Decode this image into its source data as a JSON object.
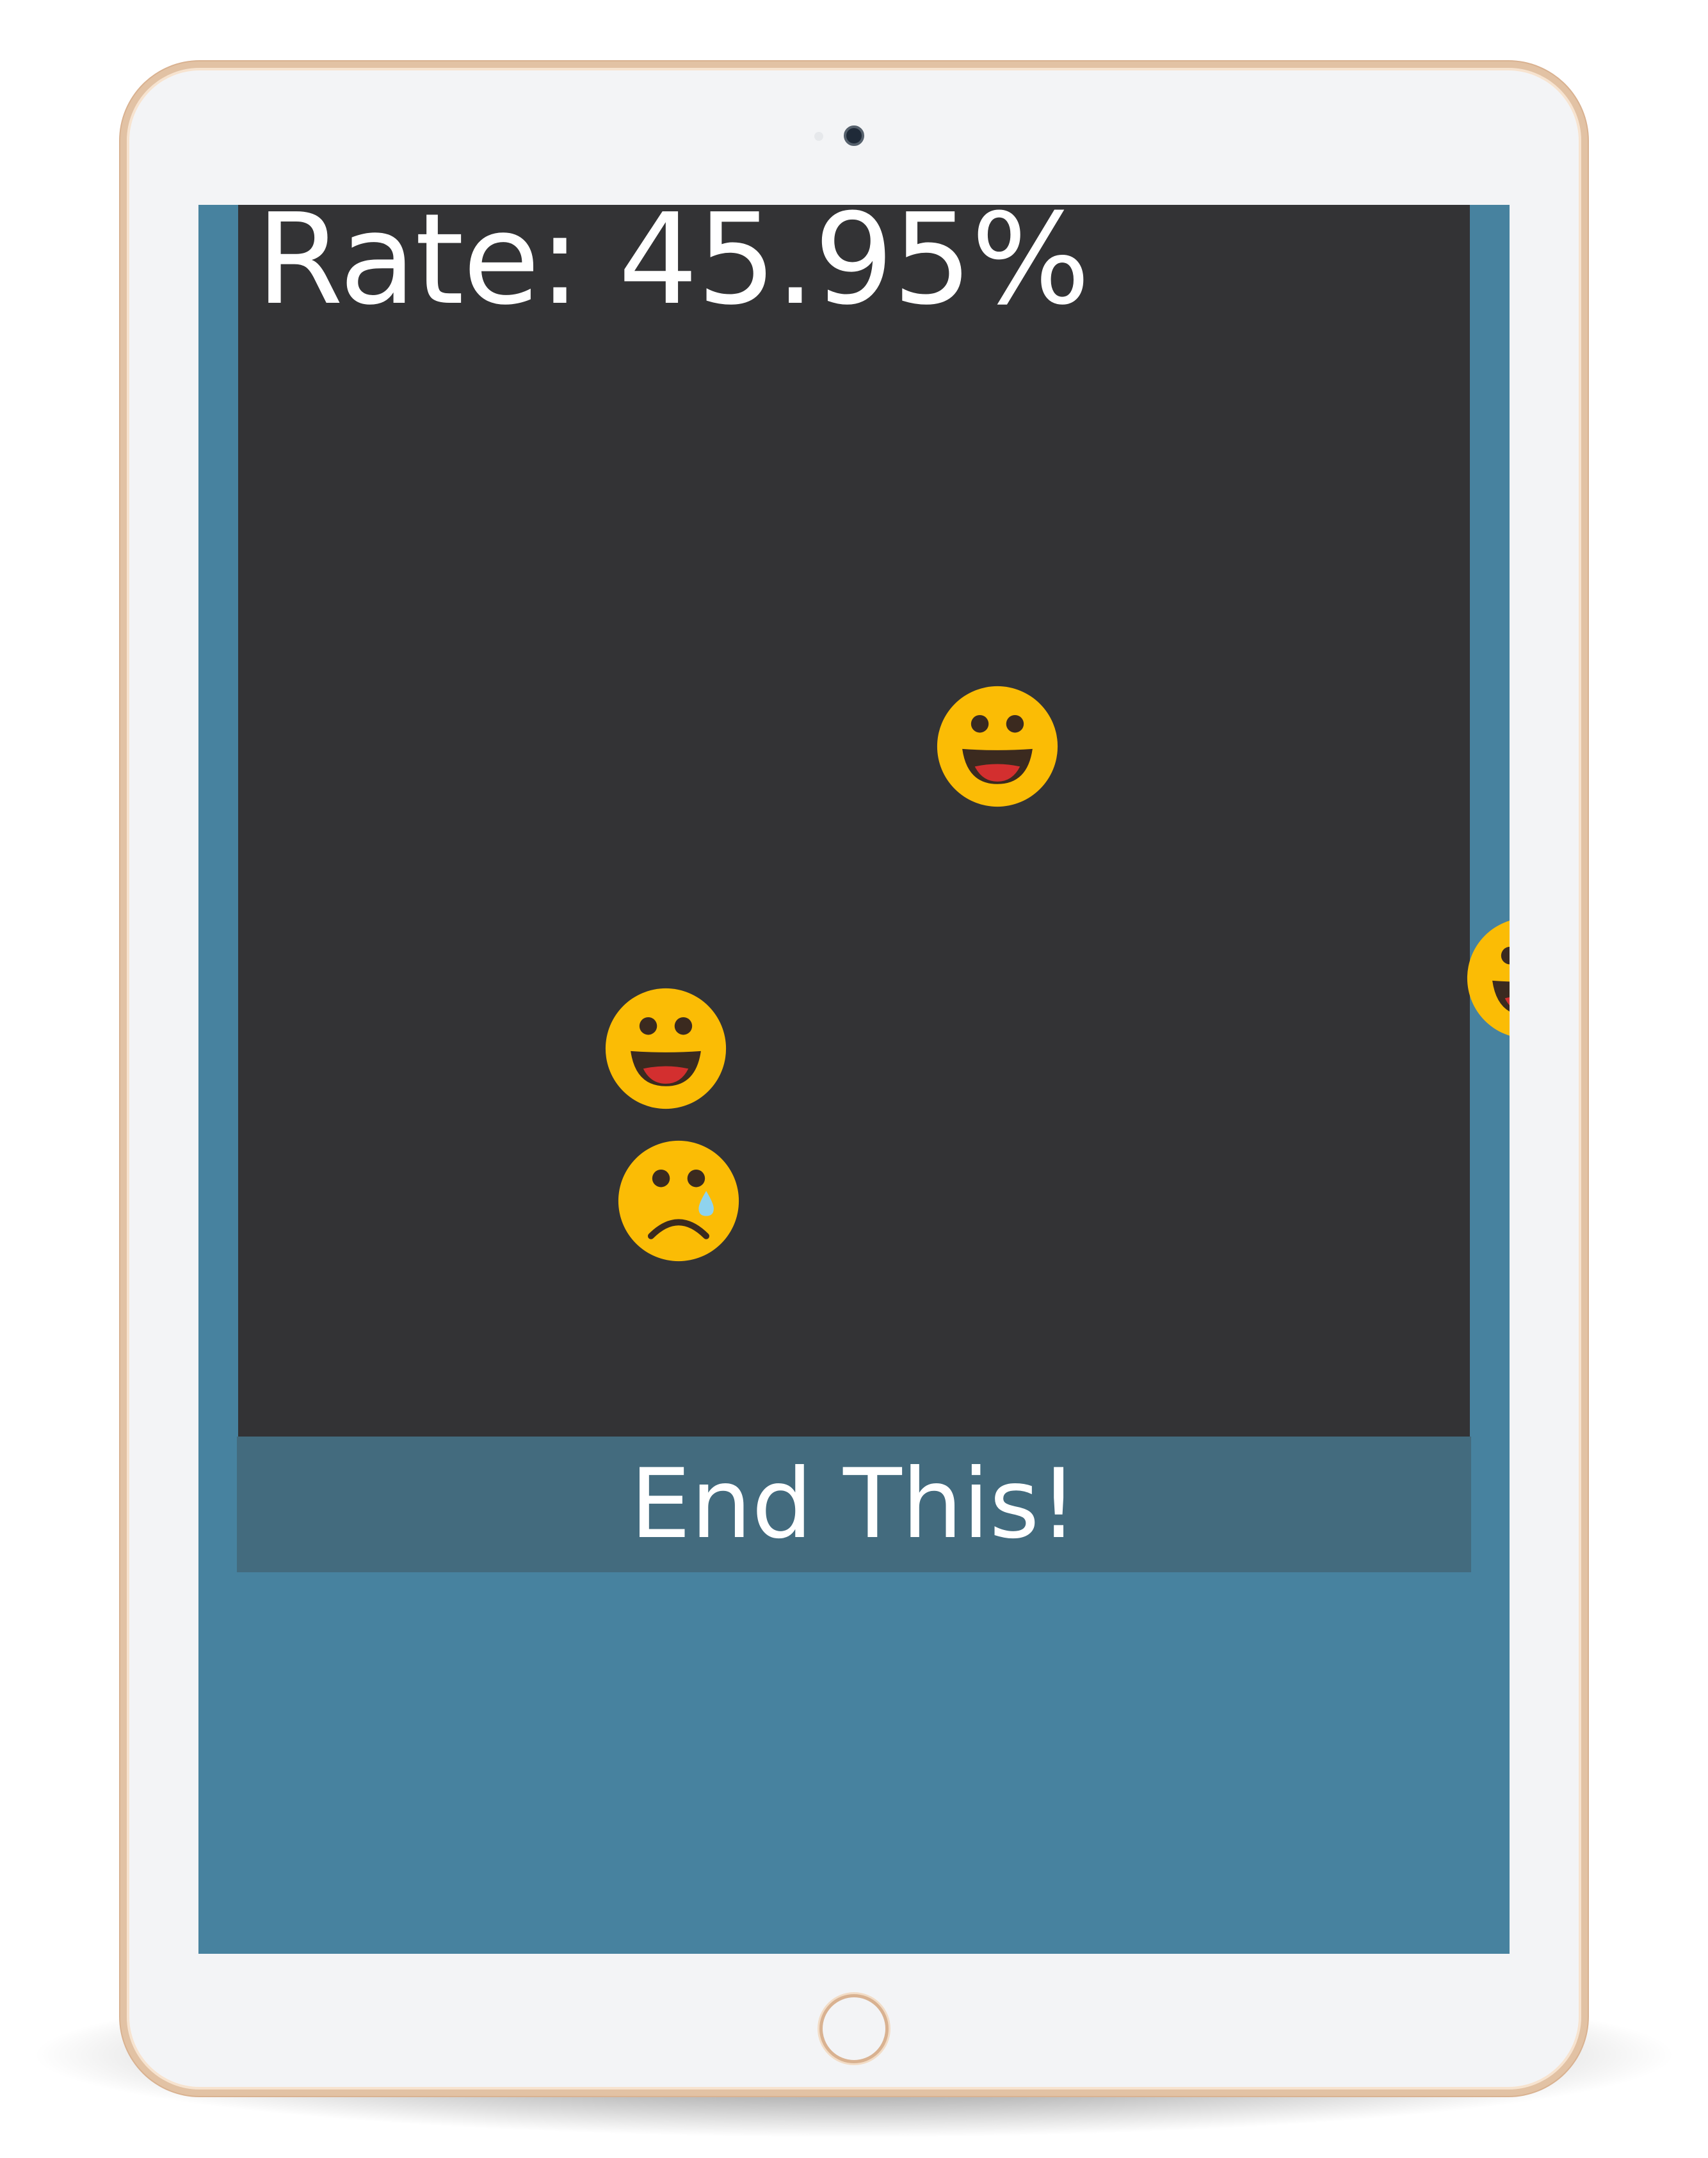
{
  "game": {
    "rate_text": "Rate: 45.95%",
    "rate_value_percent": 45.95
  },
  "end_button": {
    "label": "End This!"
  },
  "emojis": [
    {
      "id": "smiley-1",
      "type": "happy"
    },
    {
      "id": "smiley-2",
      "type": "happy"
    },
    {
      "id": "smiley-3",
      "type": "happy"
    },
    {
      "id": "sad-1",
      "type": "sad"
    }
  ],
  "colors": {
    "screen_background": "#47829f",
    "game_background": "#333335",
    "button_background": "#436b7e",
    "emoji_face": "#fbbc05",
    "emoji_features": "#3b2a1f",
    "emoji_mouth": "#d32f2f",
    "tear": "#8fd3ee",
    "tablet_frame": "#e2c2a4"
  }
}
